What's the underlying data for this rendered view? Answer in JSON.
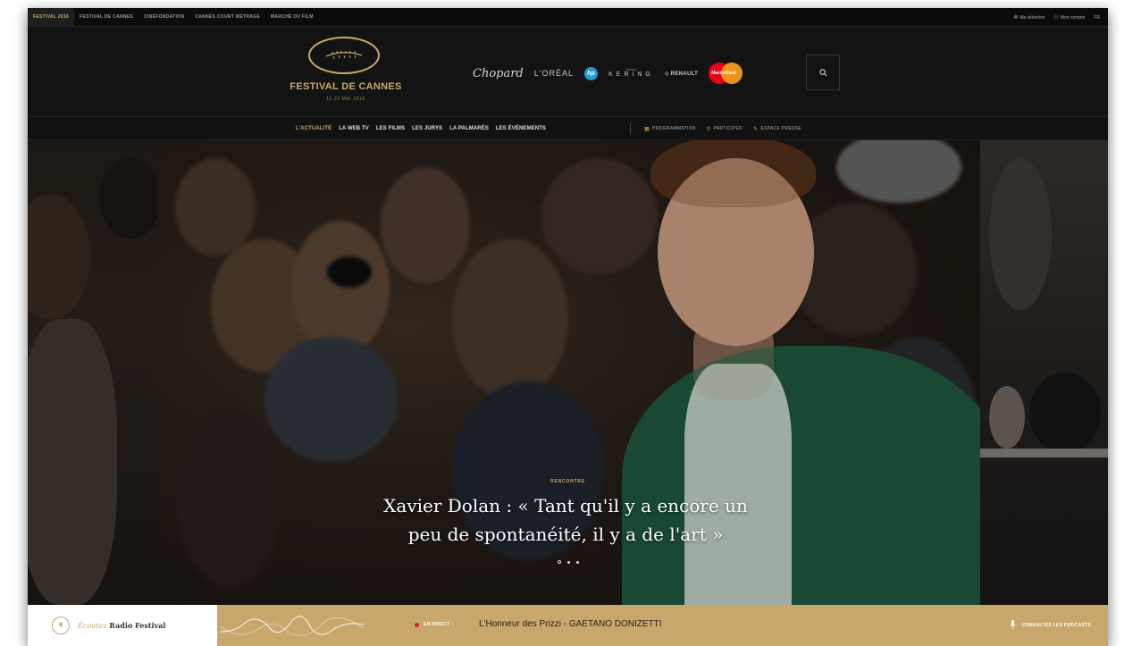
{
  "topbar": {
    "left": [
      "FESTIVAL 2016",
      "FESTIVAL DE CANNES",
      "CINÉFONDATION",
      "CANNES COURT MÉTRAGE",
      "MARCHÉ DU FILM"
    ],
    "right": [
      "Ma sélection",
      "Mon compte",
      "FR"
    ]
  },
  "header": {
    "logo_title": "FESTIVAL DE CANNES",
    "logo_dates": "11-22 MAI 2016",
    "sponsors": {
      "chopard": "Chopard",
      "loreal": "L'ORÉAL",
      "hp": "hp",
      "kering_small": "KERING",
      "kering": "KERING",
      "renault": "RENAULT",
      "mastercard": "MasterCard"
    }
  },
  "nav": {
    "items": [
      "L'ACTUALITÉ",
      "LA WEB TV",
      "LES FILMS",
      "LES JURYS",
      "LA PALMARÈS",
      "LES ÉVÉNEMENTS"
    ],
    "right": [
      "PROGRAMMATION",
      "PARTICIPER",
      "ESPACE PRESSE"
    ]
  },
  "hero": {
    "kicker": "RENCONTRE",
    "title_line1": "Xavier Dolan : « Tant qu'il y a encore un",
    "title_line2": "peu de spontanéité, il y a de l'art »"
  },
  "radio": {
    "ecoutez": "Écoutez",
    "name": "Radio Festival",
    "live": "EN DIRECT :",
    "now_playing": "L'Honneur des Prizzi - GAETANO DONIZETTI",
    "podcast": "CONSULTEZ LES PODCASTS"
  },
  "colors": {
    "gold": "#c9a96b",
    "radio_bar": "#c7a76c",
    "background": "#151515",
    "live": "#e02020"
  }
}
